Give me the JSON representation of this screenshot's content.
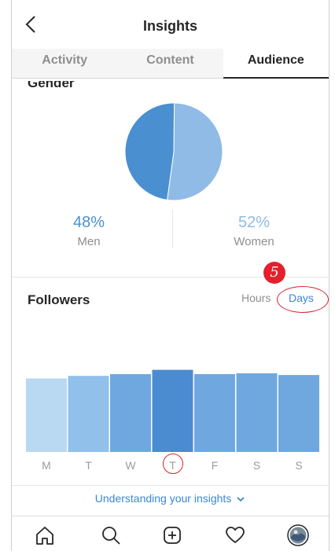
{
  "header": {
    "title": "Insights",
    "back_icon": "chevron-left-icon"
  },
  "tabs": [
    {
      "label": "Activity",
      "active": false
    },
    {
      "label": "Content",
      "active": false
    },
    {
      "label": "Audience",
      "active": true
    }
  ],
  "gender": {
    "title": "Gender",
    "men": {
      "percent": "48%",
      "label": "Men",
      "value": 48,
      "color": "#4a8fd0"
    },
    "women": {
      "percent": "52%",
      "label": "Women",
      "value": 52,
      "color": "#8fbbe6"
    }
  },
  "followers": {
    "title": "Followers",
    "toggles": {
      "hours": "Hours",
      "days": "Days",
      "selected": "days"
    },
    "badge_label": "5"
  },
  "chart_data": {
    "type": "bar",
    "categories": [
      "M",
      "T",
      "W",
      "T",
      "F",
      "S",
      "S"
    ],
    "values": [
      85,
      88,
      90,
      95,
      90,
      91,
      89
    ],
    "highlighted_index": 3,
    "ylim": [
      0,
      100
    ],
    "colors": [
      "#b9d8f1",
      "#91c0ea",
      "#6ea8de",
      "#4a8ccf",
      "#6ea8de",
      "#6ea8de",
      "#6ea8de"
    ]
  },
  "footer": {
    "understanding_link": "Understanding your insights"
  },
  "bottom_nav": [
    "home-icon",
    "search-icon",
    "add-post-icon",
    "heart-icon",
    "profile-avatar"
  ]
}
